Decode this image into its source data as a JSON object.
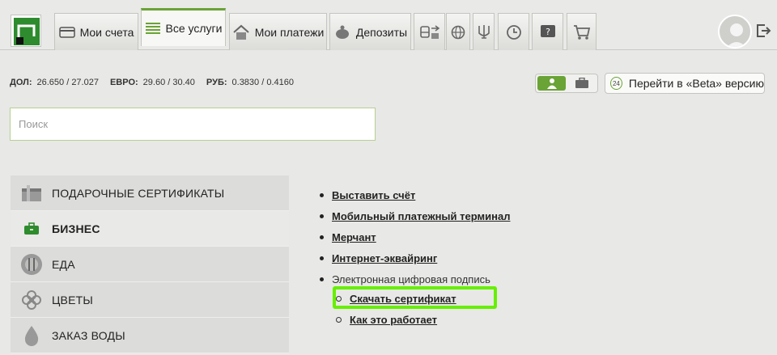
{
  "tabs": [
    {
      "label": "Мои счета",
      "icon": "card-icon"
    },
    {
      "label": "Все услуги",
      "icon": "list-icon",
      "active": true
    },
    {
      "label": "Мои платежи",
      "icon": "home-icon"
    },
    {
      "label": "Депозиты",
      "icon": "piggy-bank-icon"
    }
  ],
  "icon_tabs": [
    "transport-icon",
    "globe-icon",
    "trident-icon",
    "clock-icon",
    "help-icon",
    "cart-icon"
  ],
  "rates": [
    {
      "name": "ДОЛ:",
      "value": "26.650 / 27.027"
    },
    {
      "name": "ЕВРО:",
      "value": "29.60 / 30.40"
    },
    {
      "name": "РУБ:",
      "value": "0.3830 / 0.4160"
    }
  ],
  "beta": {
    "badge": "24",
    "label": "Перейти в «Beta» версию"
  },
  "search": {
    "placeholder": "Поиск",
    "value": ""
  },
  "categories": [
    {
      "label": "ПОДАРОЧНЫЕ СЕРТИФИКАТЫ",
      "icon": "gift-card-icon"
    },
    {
      "label": "БИЗНЕС",
      "icon": "briefcase-icon",
      "selected": true
    },
    {
      "label": "ЕДА",
      "icon": "food-icon"
    },
    {
      "label": "ЦВЕТЫ",
      "icon": "flower-icon"
    },
    {
      "label": "ЗАКАЗ ВОДЫ",
      "icon": "water-drop-icon"
    }
  ],
  "links": [
    "Выставить счёт",
    "Мобильный платежный терминал",
    "Мерчант",
    "Интернет-эквайринг"
  ],
  "signature": {
    "label": "Электронная цифровая подпись",
    "sub": [
      "Скачать сертификат",
      "Как это работает"
    ]
  },
  "colors": {
    "accent": "#6aa336",
    "highlight": "#66f000"
  }
}
